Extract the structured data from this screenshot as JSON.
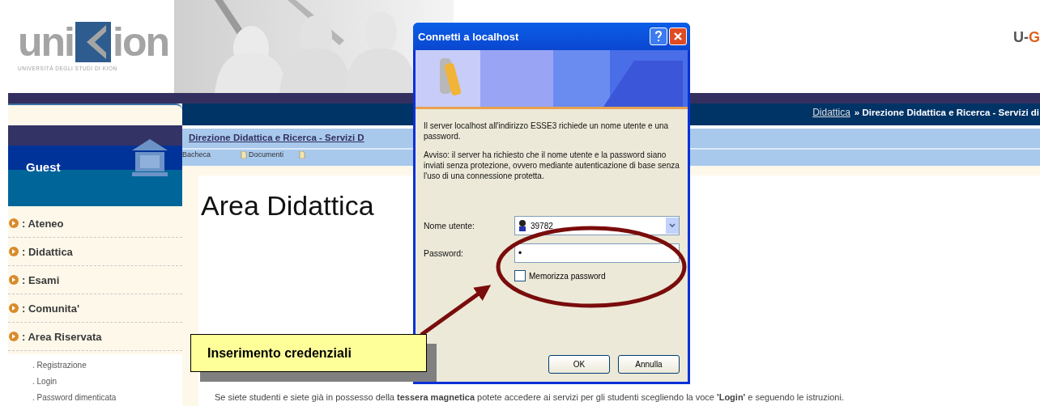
{
  "header": {
    "logo": {
      "left": "uni",
      "right": "ion",
      "subtitle": "UNIVERSITÀ DEGLI STUDI DI KION"
    },
    "partner_logo": {
      "prefix": "U-",
      "suffix": "G"
    }
  },
  "breadcrumb": {
    "link": "Didattica",
    "rest": "» Direzione Didattica e Ricerca - Servizi di"
  },
  "sidebar": {
    "user": "Guest",
    "items": [
      {
        "label": ": Ateneo"
      },
      {
        "label": ": Didattica"
      },
      {
        "label": ": Esami"
      },
      {
        "label": ": Comunita'"
      },
      {
        "label": ": Area Riservata"
      }
    ],
    "subitems": [
      {
        "label": ". Registrazione"
      },
      {
        "label": ". Login"
      },
      {
        "label": ". Password dimenticata"
      }
    ]
  },
  "main": {
    "section_link": "Direzione Didattica e Ricerca - Servizi D",
    "tabs": [
      {
        "kind": "text",
        "label": "Bacheca"
      },
      {
        "kind": "icon_text",
        "label": "Documenti"
      },
      {
        "kind": "icon"
      }
    ],
    "heading": "Area Didattica",
    "paragraph": "Se siete studenti e siete già in possesso della **tessera magnetica** potete accedere ai servizi per gli studenti scegliendo la voce **'Login'** e seguendo le istruzioni."
  },
  "dialog": {
    "title": "Connetti a localhost",
    "message": "Il server localhost all'indirizzo ESSE3 richiede un nome utente e una password.",
    "warning": "Avviso: il server ha richiesto che il nome utente e la password siano inviati senza protezione, ovvero mediante autenticazione di base senza l'uso di una connessione protetta.",
    "username_label": "Nome utente:",
    "username_value": "39782",
    "password_label": "Password:",
    "password_value": "•",
    "remember": {
      "label": "Memorizza password",
      "checked": false
    },
    "buttons": [
      "OK",
      "Annulla"
    ]
  },
  "callout": {
    "text": "Inserimento credenziali"
  }
}
